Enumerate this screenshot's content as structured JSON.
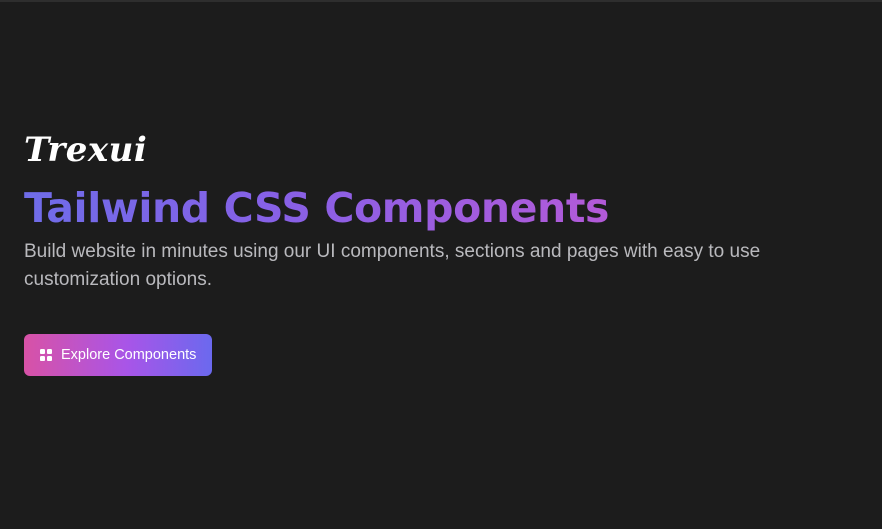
{
  "brand": {
    "name": "Trexui"
  },
  "hero": {
    "title": "Tailwind CSS Components",
    "subtitle": "Build website in minutes using our UI components, sections and pages with easy to use customization options.",
    "gradient_colors": [
      "#6f6ce8",
      "#8860e6",
      "#b35ad8"
    ]
  },
  "cta": {
    "label": "Explore Components",
    "icon": "grid-icon",
    "gradient_colors": [
      "#d852a6",
      "#a855e8",
      "#6b69ee"
    ]
  }
}
